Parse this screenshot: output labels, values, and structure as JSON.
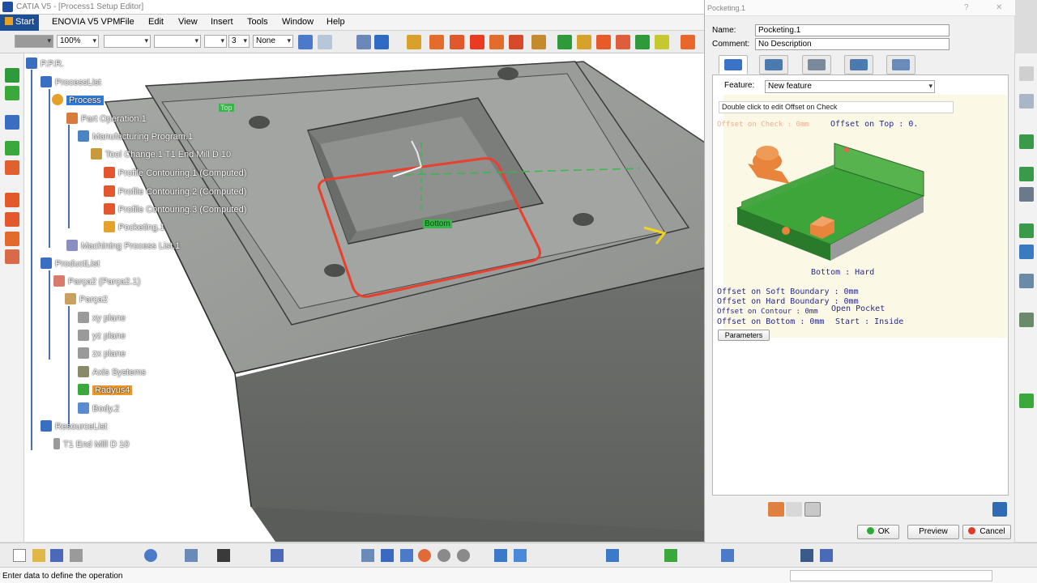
{
  "window": {
    "title": "CATIA V5 - [Process1 Setup Editor]"
  },
  "menubar": {
    "items": [
      "Start",
      "ENOVIA V5 VPM",
      "File",
      "Edit",
      "View",
      "Insert",
      "Tools",
      "Window",
      "Help"
    ]
  },
  "toolbar": {
    "zoom": "100%",
    "layer": "None",
    "thickness": "3"
  },
  "tree": {
    "root": "P.P.R.",
    "process_list": "ProcessList",
    "process": "Process",
    "part_operation": "Part Operation.1",
    "manufacturing_program": "Manufacturing Program.1",
    "tool_change": "Tool Change.1  T1 End Mill D 10",
    "profile1": "Profile Contouring.1 (Computed)",
    "profile2": "Profile Contouring.2 (Computed)",
    "profile3": "Profile Contouring.3 (Computed)",
    "pocketing": "Pocketing.1",
    "machining_list": "Machining Process List.1",
    "product_list": "ProductList",
    "product": "Parça2 (Parça2.1)",
    "part": "Parça2",
    "xy": "xy plane",
    "yz": "yz plane",
    "zx": "zx plane",
    "axis": "Axis Systems",
    "radius": "Radyus4",
    "body": "Body.2",
    "resource_list": "ResourceList",
    "tool": "T1 End Mill D 10"
  },
  "viewport": {
    "label_top": "Top",
    "label_bottom": "Bottom"
  },
  "dialog": {
    "title": "Pocketing.1",
    "name_label": "Name:",
    "name_value": "Pocketing.1",
    "comment_label": "Comment:",
    "comment_value": "No Description",
    "feature_label": "Feature:",
    "feature_value": "New feature",
    "tooltip": "Double click to edit Offset on Check",
    "offset_check": "Offset on Check : 0mm",
    "offset_top": "Offset on Top : 0.",
    "bottom_hard": "Bottom : Hard",
    "offset_soft": "Offset on Soft Boundary : 0mm",
    "offset_hard": "Offset on Hard Boundary : 0mm",
    "offset_contour": "Offset on Contour : 0mm",
    "open_pocket": "Open Pocket",
    "offset_bottom": "Offset on Bottom : 0mm",
    "start_inside": "Start : Inside",
    "parameters_btn": "Parameters",
    "ok_btn": "OK",
    "preview_btn": "Preview",
    "cancel_btn": "Cancel",
    "help_glyph": "?",
    "close_glyph": "✕"
  },
  "status": {
    "text": "Enter data to define the operation"
  },
  "colors": {
    "tree_highlight": "#2f7de0",
    "tree_selected_orange": "#f39a26",
    "part_gray": "#8d8f8c",
    "pocket_red": "#e8402c",
    "picture_green": "#3ea53a",
    "picture_orange": "#e8843c"
  }
}
